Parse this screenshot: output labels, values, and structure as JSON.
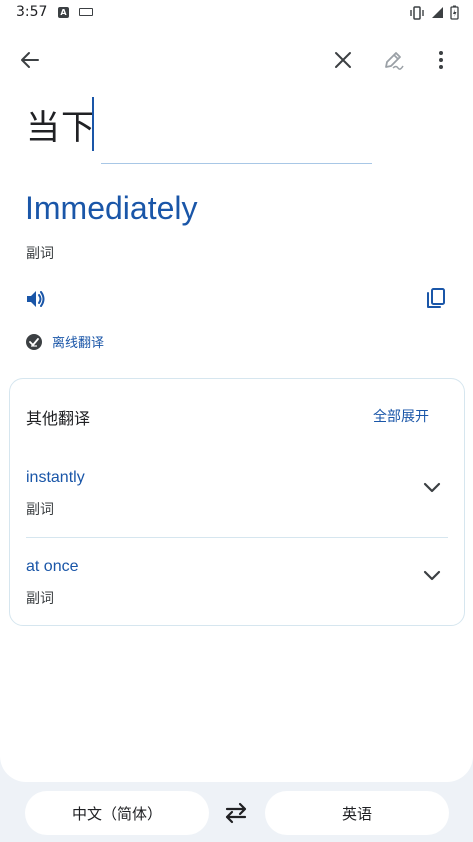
{
  "status_bar": {
    "time": "3:57"
  },
  "toolbar": {
    "back_icon": "arrow-left-icon",
    "clear_icon": "close-icon",
    "handwrite_icon": "pen-icon",
    "more_icon": "more-vert-icon"
  },
  "source": {
    "text": "当下"
  },
  "result": {
    "translation": "Immediately",
    "part_of_speech": "副词",
    "offline_label": "离线翻译"
  },
  "other_translations": {
    "title": "其他翻译",
    "expand_all": "全部展开",
    "items": [
      {
        "word": "instantly",
        "pos": "副词"
      },
      {
        "word": "at once",
        "pos": "副词"
      }
    ]
  },
  "languages": {
    "source": "中文（简体）",
    "target": "英语"
  },
  "colors": {
    "accent": "#1a56a8",
    "background": "#eef2f7",
    "card_border": "#d6e6ef"
  }
}
